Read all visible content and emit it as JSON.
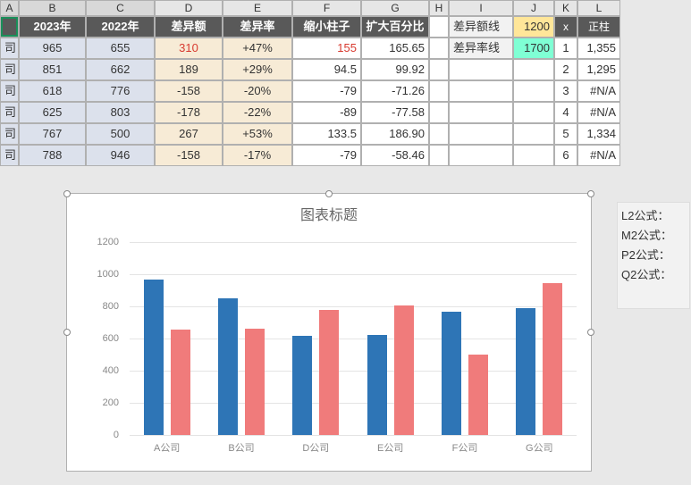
{
  "columns": [
    "A",
    "B",
    "C",
    "D",
    "E",
    "F",
    "G",
    "H",
    "I",
    "J",
    "K",
    "L"
  ],
  "headers": {
    "B": "2023年",
    "C": "2022年",
    "D": "差异额",
    "E": "差异率",
    "F": "缩小柱子",
    "G": "扩大百分比",
    "K": "x",
    "L": "正柱"
  },
  "sideLabels": {
    "eLine": "差异额线高",
    "rLine": "差异率线高"
  },
  "sideValues": {
    "eLine": "1200",
    "rLine": "1700"
  },
  "rows": [
    {
      "a": "司",
      "b": "965",
      "c": "655",
      "d": "310",
      "e": "+47%",
      "f": "155",
      "g": "165.65",
      "k": "1",
      "l": "1,355",
      "pos": true
    },
    {
      "a": "司",
      "b": "851",
      "c": "662",
      "d": "189",
      "e": "+29%",
      "f": "94.5",
      "g": "99.92",
      "k": "2",
      "l": "1,295",
      "pos": false
    },
    {
      "a": "司",
      "b": "618",
      "c": "776",
      "d": "-158",
      "e": "-20%",
      "f": "-79",
      "g": "-71.26",
      "k": "3",
      "l": "#N/A",
      "pos": false
    },
    {
      "a": "司",
      "b": "625",
      "c": "803",
      "d": "-178",
      "e": "-22%",
      "f": "-89",
      "g": "-77.58",
      "k": "4",
      "l": "#N/A",
      "pos": false
    },
    {
      "a": "司",
      "b": "767",
      "c": "500",
      "d": "267",
      "e": "+53%",
      "f": "133.5",
      "g": "186.90",
      "k": "5",
      "l": "1,334",
      "pos": false
    },
    {
      "a": "司",
      "b": "788",
      "c": "946",
      "d": "-158",
      "e": "-17%",
      "f": "-79",
      "g": "-58.46",
      "k": "6",
      "l": "#N/A",
      "pos": false
    }
  ],
  "chart_data": {
    "type": "bar",
    "title": "图表标题",
    "categories": [
      "A公司",
      "B公司",
      "D公司",
      "E公司",
      "F公司",
      "G公司"
    ],
    "series": [
      {
        "name": "2023年",
        "values": [
          965,
          851,
          618,
          625,
          767,
          788
        ]
      },
      {
        "name": "2022年",
        "values": [
          655,
          662,
          776,
          803,
          500,
          946
        ]
      }
    ],
    "ylim": [
      0,
      1200
    ],
    "yticks": [
      0,
      200,
      400,
      600,
      800,
      1000,
      1200
    ]
  },
  "notes": {
    "l2": "L2公式：",
    "m2": "M2公式：",
    "p2": "P2公式：",
    "q2": "Q2公式："
  }
}
